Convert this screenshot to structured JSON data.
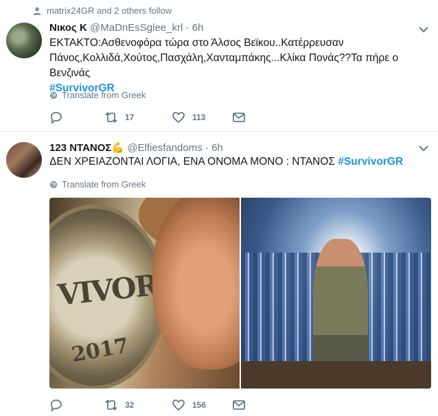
{
  "tweet1": {
    "social_context": "matrix24GR and 2 others follow",
    "fullname": "Νικος Κ",
    "handle": "@MaDnEsSglee_krl",
    "dot": "·",
    "time": "6h",
    "text": "ΕΚΤΑΚΤΟ:Ασθενοφόρα τώρα στο Άλσος Βεϊκου..Κατέρρευσαν Πάνος,Κολλιδά,Χούτος,Πασχάλη,Χανταμπάκης...Κλίκα Πονάς??Τα πήρε ο Βενζινάς",
    "hashtag": "#SurvivorGR",
    "translate": "Translate from Greek",
    "retweets": "17",
    "likes": "113"
  },
  "tweet2": {
    "fullname": "123 ΝΤΑΝΟΣ",
    "emoji": "💪",
    "handle": "@Elfiesfandoms",
    "dot": "·",
    "time": "6h",
    "text": "ΔΕΝ ΧΡΕΙΑΖΟΝΤΑΙ ΛΟΓΙΑ, ΕΝΑ ΟΝΟΜΑ ΜΟΝΟ : ΝΤΑΝΟΣ",
    "hashtag": "#SurvivorGR",
    "translate": "Translate from Greek",
    "retweets": "32",
    "likes": "156",
    "photo_left": {
      "coin_text": "VIVOR",
      "coin_year": "2017"
    }
  },
  "colors": {
    "link": "#1b95e0",
    "secondary_text": "#657786",
    "border": "#e6ecf0"
  }
}
